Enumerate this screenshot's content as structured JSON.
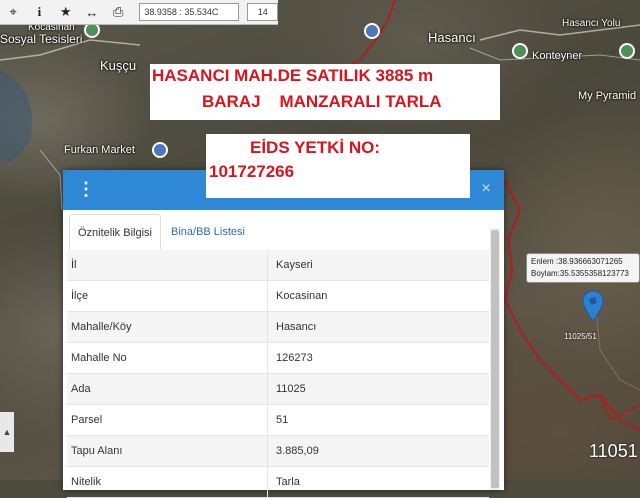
{
  "toolbar": {
    "icons": [
      "crosshair-icon",
      "info-icon",
      "star-icon",
      "arrows-horizontal-icon",
      "print-icon"
    ],
    "coordinate": "38.9358 : 35.534C",
    "zoom": "14"
  },
  "map": {
    "labels": {
      "sosyal": "Sosyal Tesisleri",
      "kocasinan": "Kocasinan",
      "kuscu": "Kuşçu",
      "hasanci": "Hasancı",
      "hasanci_yolu": "Hasancı Yolu",
      "konteyner": "Konteyner",
      "my_pyramid": "My Pyramid",
      "furkan_market": "Furkan Market"
    }
  },
  "banner1": {
    "line1": "HASANCI MAH.DE SATILIK 3885 m",
    "line2": "BARAJ    MANZARALI TARLA"
  },
  "banner2": {
    "line1": "EİDS YETKİ NO:",
    "line2": "101727266"
  },
  "panel": {
    "close_label": "×",
    "kebab_label": "⋮",
    "tabs": [
      {
        "label": "Öznitelik Bilgisi",
        "active": true
      },
      {
        "label": "Bina/BB Listesi",
        "active": false
      }
    ],
    "rows": [
      {
        "key": "İl",
        "value": "Kayseri"
      },
      {
        "key": "İlçe",
        "value": "Kocasinan"
      },
      {
        "key": "Mahalle/Köy",
        "value": "Hasancı"
      },
      {
        "key": "Mahalle No",
        "value": "126273"
      },
      {
        "key": "Ada",
        "value": "11025"
      },
      {
        "key": "Parsel",
        "value": "51"
      },
      {
        "key": "Tapu Alanı",
        "value": "3.885,09"
      },
      {
        "key": "Nitelik",
        "value": "Tarla"
      }
    ]
  },
  "callout": {
    "lat": "Enlem :38.936663071265",
    "lon": "Boylam:35.5355358123773"
  },
  "parcel_small": "11025/51",
  "parcel_big": "11051",
  "colors": {
    "panel_header": "#2e88d6",
    "banner_text": "#d8141c",
    "border_red": "#b01e1e"
  }
}
